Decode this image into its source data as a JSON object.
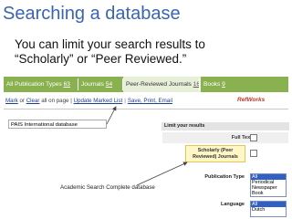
{
  "slide": {
    "title": "Searching a database",
    "subtitle_line1": "You can limit your search results to",
    "subtitle_line2": "“Scholarly” or “Peer Reviewed.”"
  },
  "tabs": [
    {
      "label": "All Publication Types",
      "count": "63"
    },
    {
      "label": "Journals",
      "count": "54"
    },
    {
      "label": "Peer-Reviewed Journals",
      "count": "16"
    },
    {
      "label": "Books",
      "count": "9"
    }
  ],
  "toolbar": {
    "mark": "Mark",
    "or": " or ",
    "clear": "Clear",
    "all_on_page": " all on page | ",
    "update": "Update Marked List",
    "save": "Save, Print, Email",
    "refworks": "RefWorks"
  },
  "labels": {
    "pais": "PAIS International database",
    "asc": "Academic Search Complete database"
  },
  "limit_panel": {
    "header": "Limit your results",
    "full_text": "Full Text",
    "scholarly": "Scholarly (Peer Reviewed) Journals",
    "publication_type": "Publication Type",
    "publication_options": [
      "All",
      "Periodical",
      "Newspaper",
      "Book"
    ],
    "language": "Language",
    "language_options": [
      "All",
      "Dutch"
    ]
  },
  "colors": {
    "title": "#3a64b3",
    "tab_green": "#8ab14f",
    "highlight_yellow": "#fff6c6",
    "selection_blue": "#3160c4"
  }
}
